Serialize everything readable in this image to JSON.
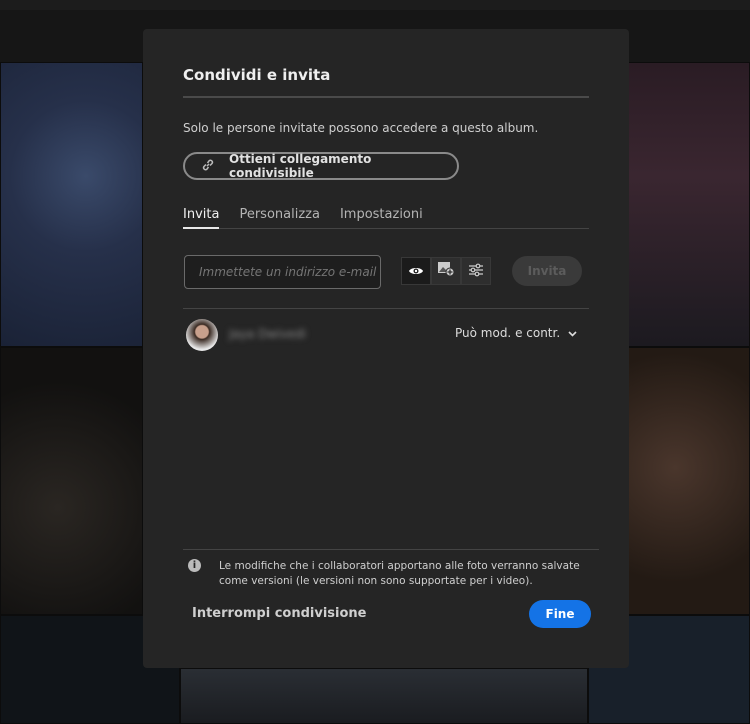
{
  "dialog": {
    "title": "Condividi e invita",
    "description": "Solo le persone invitate possono accedere a questo album.",
    "link_button": "Ottieni collegamento condivisibile",
    "tabs": [
      {
        "label": "Invita"
      },
      {
        "label": "Personalizza"
      },
      {
        "label": "Impostazioni"
      }
    ],
    "email_placeholder": "Immettete un indirizzo e-mail",
    "invite_button": "Invita",
    "collaborator": {
      "name": "Jaya Dwivedi",
      "permission": "Può mod. e contr."
    },
    "note": "Le modifiche che i collaboratori apportano alle foto verranno salvate come versioni (le versioni non sono supportate per i video).",
    "stop_sharing": "Interrompi condivisione",
    "done_button": "Fine"
  },
  "colors": {
    "accent": "#1473e6",
    "dialog_bg": "#252525"
  }
}
